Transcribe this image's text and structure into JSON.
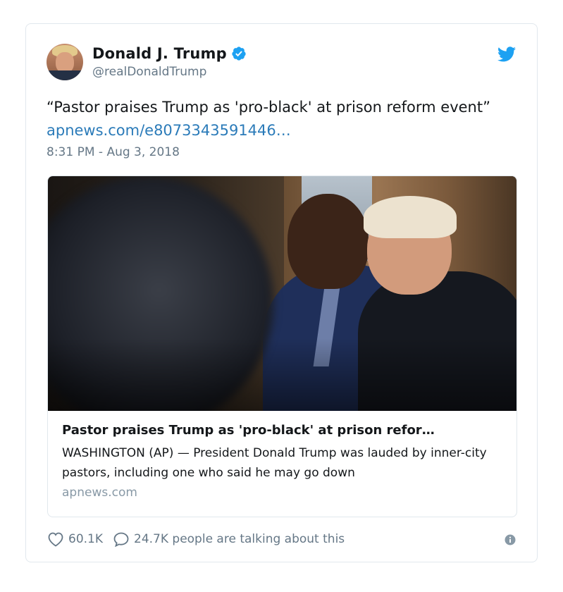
{
  "author": {
    "name": "Donald J. Trump",
    "handle": "@realDonaldTrump",
    "avatar_icon": "profile-photo",
    "verified_icon": "verified-badge-icon"
  },
  "tweet": {
    "text_quote": "“Pastor praises Trump as 'pro-black' at prison reform event” ",
    "link_text": "apnews.com/e8073343591446…",
    "timestamp": "8:31 PM - Aug 3, 2018"
  },
  "link_card": {
    "title": "Pastor praises Trump as 'pro-black' at prison refor…",
    "description": "WASHINGTON (AP) — President Donald Trump was lauded by inner-city pastors, including one who said he may go down",
    "domain": "apnews.com"
  },
  "footer": {
    "likes": "60.1K",
    "talking": "24.7K people are talking about this"
  },
  "colors": {
    "link": "#2b7bb9",
    "verified": "#1da1f2",
    "twitter_bird": "#1da1f2",
    "muted": "#657786",
    "border": "#e1e8ed"
  }
}
